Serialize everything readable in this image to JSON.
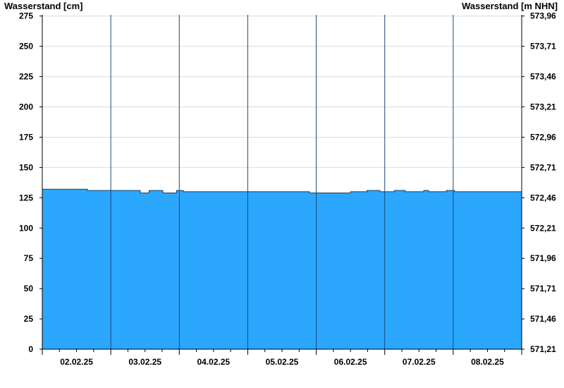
{
  "chart_data": {
    "type": "area",
    "left_axis_label": "Wasserstand [cm]",
    "right_axis_label": "Wasserstand [m NHN]",
    "y_ticks_left": [
      "0",
      "25",
      "50",
      "75",
      "100",
      "125",
      "150",
      "175",
      "200",
      "225",
      "250",
      "275"
    ],
    "y_ticks_right": [
      "571,21",
      "571,46",
      "571,71",
      "571,96",
      "572,21",
      "572,46",
      "572,71",
      "572,96",
      "573,21",
      "573,46",
      "573,71",
      "573,96"
    ],
    "x_tick_labels": [
      "02.02.25",
      "03.02.25",
      "04.02.25",
      "05.02.25",
      "06.02.25",
      "07.02.25",
      "08.02.25"
    ],
    "ylim": [
      0,
      276
    ],
    "xlim": [
      0,
      7
    ],
    "grid": true,
    "series": [
      {
        "color": "#2ba7fe",
        "x": [
          0,
          0.66,
          0.66,
          1.43,
          1.43,
          1.56,
          1.56,
          1.76,
          1.76,
          1.96,
          1.96,
          2.06,
          2.06,
          3.0,
          3.0,
          3.9,
          3.9,
          4.5,
          4.5,
          4.74,
          4.74,
          4.93,
          4.93,
          5.14,
          5.14,
          5.3,
          5.3,
          5.57,
          5.57,
          5.64,
          5.64,
          5.9,
          5.9,
          6.02,
          6.02,
          7.0
        ],
        "y": [
          132,
          132,
          131,
          131,
          129,
          129,
          131,
          131,
          129,
          129,
          131,
          131,
          130,
          130,
          130,
          130,
          129,
          129,
          130,
          130,
          131,
          131,
          130,
          130,
          131,
          131,
          130,
          130,
          131,
          131,
          130,
          130,
          131,
          131,
          130,
          130
        ]
      }
    ]
  }
}
